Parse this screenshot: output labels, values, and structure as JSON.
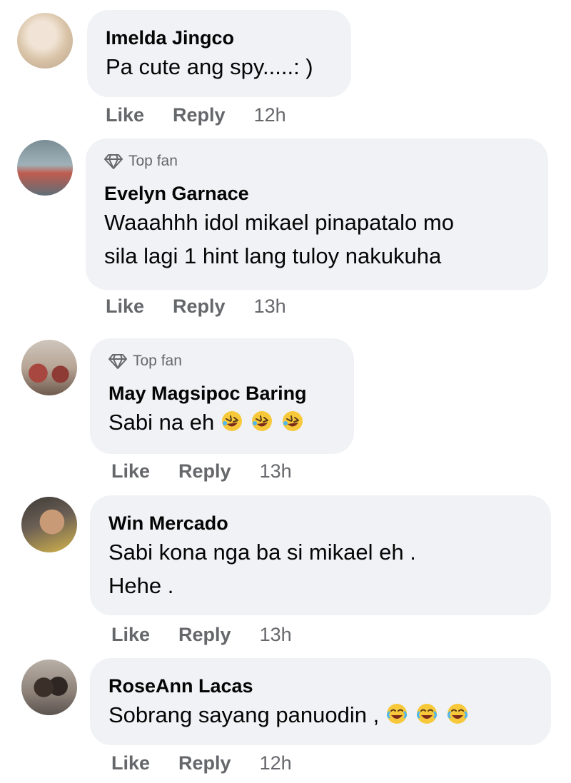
{
  "comments": [
    {
      "name": "Imelda Jingco",
      "badge": "",
      "lines": [
        "Pa cute ang spy.....: )"
      ],
      "emojis": [],
      "like": "Like",
      "reply": "Reply",
      "time": "12h"
    },
    {
      "name": "Evelyn Garnace",
      "badge": "Top fan",
      "lines": [
        "Waaahhh idol mikael pinapatalo mo",
        "sila lagi 1 hint lang tuloy nakukuha"
      ],
      "emojis": [],
      "like": "Like",
      "reply": "Reply",
      "time": "13h"
    },
    {
      "name": "May Magsipoc Baring",
      "badge": "Top fan",
      "lines": [
        "Sabi na eh"
      ],
      "emojis": [
        "rolling-on-floor-laughing",
        "rolling-on-floor-laughing",
        "rolling-on-floor-laughing"
      ],
      "like": "Like",
      "reply": "Reply",
      "time": "13h"
    },
    {
      "name": "Win Mercado",
      "badge": "",
      "lines": [
        "Sabi kona nga ba si mikael eh .",
        "Hehe ."
      ],
      "emojis": [],
      "like": "Like",
      "reply": "Reply",
      "time": "13h"
    },
    {
      "name": "RoseAnn Lacas",
      "badge": "",
      "lines": [
        "Sobrang sayang panuodin ,"
      ],
      "emojis": [
        "face-with-tears-of-joy",
        "face-with-tears-of-joy",
        "face-with-tears-of-joy"
      ],
      "like": "Like",
      "reply": "Reply",
      "time": "12h"
    }
  ],
  "icons": {
    "top_fan_badge": "diamond-icon"
  },
  "colors": {
    "bubble": "#f0f2f5",
    "meta": "#65676b",
    "text": "#050505",
    "emoji": "#f7c93a"
  }
}
